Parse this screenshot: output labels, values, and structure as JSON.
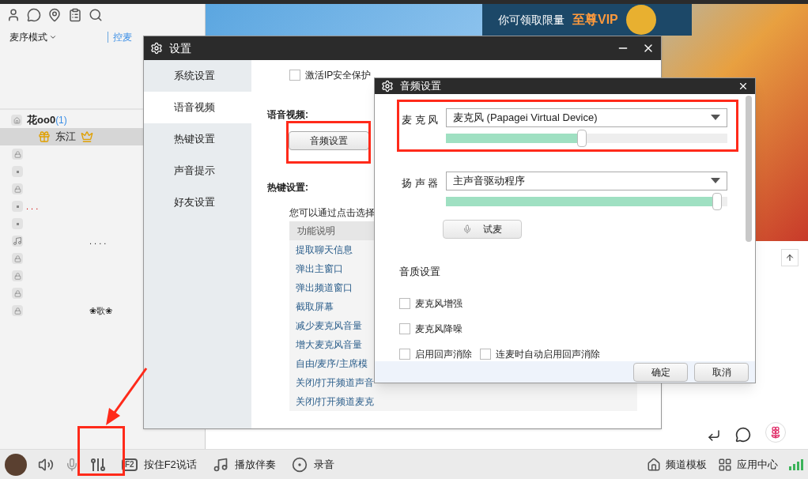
{
  "sidebar": {
    "mode": "麦序模式",
    "mic_control": "控麦",
    "channel": {
      "name": "花oo0",
      "count": "(1)",
      "members": [
        {
          "name": "东江",
          "selected": true
        }
      ]
    },
    "subchannels": [
      {
        "kind": "lock"
      },
      {
        "kind": "dot"
      },
      {
        "kind": "lock"
      },
      {
        "kind": "dot",
        "name": ". . ."
      },
      {
        "kind": "dot"
      },
      {
        "kind": "music",
        "name": ". . . ."
      },
      {
        "kind": "lock"
      },
      {
        "kind": "lock"
      },
      {
        "kind": "lock"
      },
      {
        "kind": "lock",
        "name": "❀歌❀"
      }
    ]
  },
  "banner": {
    "promo": "你可领取限量",
    "vip": "至尊VIP"
  },
  "settings_dialog": {
    "title": "设置",
    "nav": [
      {
        "label": "系统设置",
        "selected": false
      },
      {
        "label": "语音视频",
        "selected": true
      },
      {
        "label": "热键设置",
        "selected": false
      },
      {
        "label": "声音提示",
        "selected": false
      },
      {
        "label": "好友设置",
        "selected": false
      }
    ],
    "ip_protection": {
      "label": "激活IP安全保护",
      "checked": false
    },
    "voice_heading": "语音视频:",
    "audio_button": "音频设置",
    "hotkey_heading": "热键设置:",
    "hotkey_hint": "您可以通过点击选择",
    "hotkey_table": {
      "header": "功能说明",
      "rows": [
        "提取聊天信息",
        "弹出主窗口",
        "弹出频道窗口",
        "截取屏幕",
        "减少麦克风音量",
        "增大麦克风音量",
        "自由/麦序/主席模",
        "关闭/打开频道声音",
        "关闭/打开频道麦克"
      ]
    }
  },
  "audio_dialog": {
    "title": "音频设置",
    "devices": [
      {
        "label": "麦 克 风",
        "value": "麦克风 (Papagei Virtual Device)",
        "level": 0.5,
        "highlighted": true
      },
      {
        "label": "扬 声 器",
        "value": "主声音驱动程序",
        "level": 0.98,
        "highlighted": false
      }
    ],
    "test_button": "试麦",
    "quality_heading": "音质设置",
    "options": [
      [
        {
          "label": "麦克风增强",
          "checked": false
        }
      ],
      [
        {
          "label": "麦克风降噪",
          "checked": false
        }
      ],
      [
        {
          "label": "启用回声消除",
          "checked": false
        },
        {
          "label": "连麦时自动启用回声消除",
          "checked": false
        }
      ]
    ],
    "buttons": [
      "确定",
      "取消"
    ]
  },
  "bottom_bar": {
    "items": [
      {
        "kind": "key",
        "key": "F2",
        "label": "按住F2说话"
      },
      {
        "kind": "music",
        "label": "播放伴奏"
      },
      {
        "kind": "record",
        "label": "录音"
      }
    ],
    "right": [
      {
        "kind": "template",
        "label": "频道模板"
      },
      {
        "kind": "apps",
        "label": "应用中心"
      }
    ]
  }
}
